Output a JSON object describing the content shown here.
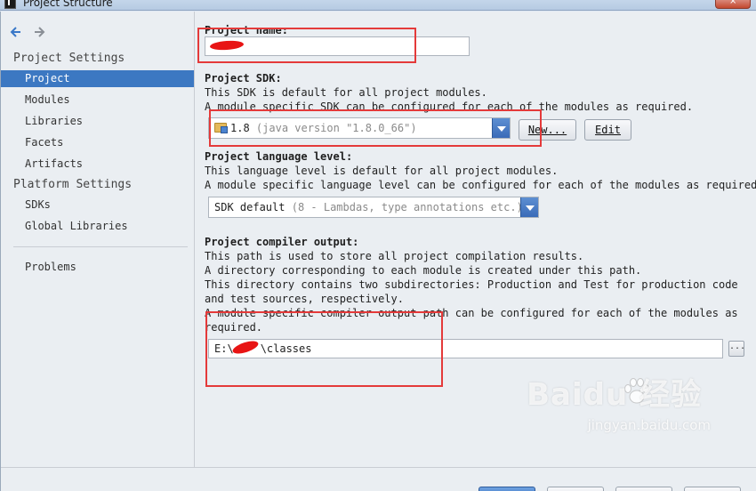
{
  "window": {
    "title": "Project Structure",
    "close_glyph": "×"
  },
  "sidebar": {
    "back_icon": "arrow-left-icon",
    "forward_icon": "arrow-right-icon",
    "project_settings_title": "Project Settings",
    "project_items": [
      "Project",
      "Modules",
      "Libraries",
      "Facets",
      "Artifacts"
    ],
    "selected_item": "Project",
    "platform_settings_title": "Platform Settings",
    "platform_items": [
      "SDKs",
      "Global Libraries"
    ],
    "other_items": [
      "Problems"
    ]
  },
  "project_name": {
    "label": "Project name:",
    "value": ""
  },
  "sdk": {
    "label": "Project SDK:",
    "line1": "This SDK is default for all project modules.",
    "line2": "A module specific SDK can be configured for each of the modules as required.",
    "selected_version": "1.8",
    "selected_detail": "(java version \"1.8.0_66\")",
    "new_button": "New...",
    "edit_button": "Edit",
    "icon": "folder-sdk-icon"
  },
  "language_level": {
    "label": "Project language level:",
    "line1": "This language level is default for all project modules.",
    "line2": "A module specific language level can be configured for each of the modules as required.",
    "selected": "SDK default",
    "selected_detail": "(8 - Lambdas, type annotations etc.)"
  },
  "compiler_output": {
    "label": "Project compiler output:",
    "lines": [
      "This path is used to store all project compilation results.",
      "A directory corresponding to each module is created under this path.",
      "This directory contains two subdirectories: Production and Test for production code",
      "and test sources, respectively.",
      "A module specific compiler output path can be configured for each of the modules as",
      "required."
    ],
    "path_prefix": "E:\\",
    "path_suffix": "\\classes",
    "browse_label": "..."
  },
  "watermark": {
    "brand": "Baidu 经验",
    "url": "jingyan.baidu.com"
  },
  "colors": {
    "selection": "#3c78c2",
    "annotation_red": "#e43a3a",
    "combo_arrow": "#3a6bb8"
  }
}
